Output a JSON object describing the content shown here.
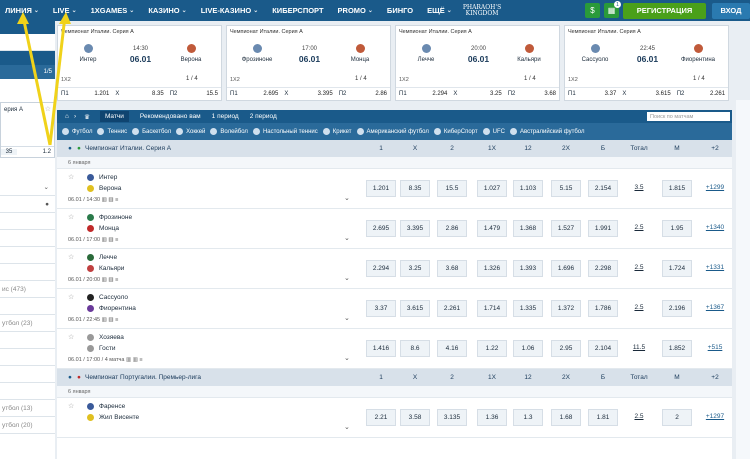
{
  "nav": {
    "items": [
      "ЛИНИЯ",
      "LIVE",
      "1XGAMES",
      "КАЗИНО",
      "LIVE-КАЗИНО",
      "КИБЕРСПОРТ",
      "PROMO",
      "БИНГО",
      "ЕЩЁ"
    ],
    "logo_line1": "PHARAOH'S",
    "logo_line2": "KINGDOM",
    "register": "РЕГИСТРАЦИЯ",
    "login": "ВХОД",
    "dollar": "$",
    "gift_badge": "1",
    "colors": {
      "nav": "#1a5a8a",
      "register": "#4aa01a"
    }
  },
  "sidebar": {
    "pager": "1/5",
    "card_text": "ерия А",
    "odds_prefix": "35",
    "odds_val": "1.2",
    "rows": [
      "",
      "",
      "",
      "",
      "",
      "",
      "ис (473)",
      "",
      "утбол (23)",
      "",
      "",
      "",
      "",
      "",
      "утбол (13)",
      "",
      "утбол (20)"
    ]
  },
  "cards": [
    {
      "league": "Чемпионат Италии. Серия А",
      "home": "Интер",
      "away": "Верона",
      "time": "14:30",
      "date": "06.01",
      "market": "1X2",
      "page": "1 / 4",
      "odds": [
        {
          "k": "П1",
          "v": "1.201"
        },
        {
          "k": "X",
          "v": "8.35"
        },
        {
          "k": "П2",
          "v": "15.5"
        }
      ]
    },
    {
      "league": "Чемпионат Италии. Серия А",
      "home": "Фрозиноне",
      "away": "Монца",
      "time": "17:00",
      "date": "06.01",
      "market": "1X2",
      "page": "1 / 4",
      "odds": [
        {
          "k": "П1",
          "v": "2.695"
        },
        {
          "k": "X",
          "v": "3.395"
        },
        {
          "k": "П2",
          "v": "2.86"
        }
      ]
    },
    {
      "league": "Чемпионат Италии. Серия А",
      "home": "Лечче",
      "away": "Кальяри",
      "time": "20:00",
      "date": "06.01",
      "market": "1X2",
      "page": "1 / 4",
      "odds": [
        {
          "k": "П1",
          "v": "2.294"
        },
        {
          "k": "X",
          "v": "3.25"
        },
        {
          "k": "П2",
          "v": "3.68"
        }
      ]
    },
    {
      "league": "Чемпионат Италии. Серия А",
      "home": "Сассуоло",
      "away": "Фиорентина",
      "time": "22:45",
      "date": "06.01",
      "market": "1X2",
      "page": "1 / 4",
      "odds": [
        {
          "k": "П1",
          "v": "3.37"
        },
        {
          "k": "X",
          "v": "3.615"
        },
        {
          "k": "П2",
          "v": "2.261"
        }
      ]
    }
  ],
  "tabs": [
    "Матчи",
    "Рекомендовано вам",
    "1 период",
    "2 период"
  ],
  "search_placeholder": "Поиск по матчам",
  "sports": [
    "Футбол",
    "Теннис",
    "Баскетбол",
    "Хоккей",
    "Волейбол",
    "Настольный теннис",
    "Крикет",
    "Американский футбол",
    "КиберСпорт",
    "UFC",
    "Австралийский футбол"
  ],
  "columns": [
    "1",
    "X",
    "2",
    "1X",
    "12",
    "2X",
    "Б",
    "Тотал",
    "М",
    "+2"
  ],
  "leagues": [
    {
      "name": "Чемпионат Италии. Серия А",
      "date": "6 января",
      "matches": [
        {
          "home": "Интер",
          "away": "Верона",
          "info": "06.01 / 14:30",
          "odds": [
            "1.201",
            "8.35",
            "15.5",
            "1.027",
            "1.103",
            "5.15",
            "2.154",
            "3.5",
            "1.815"
          ],
          "more": "+1299"
        },
        {
          "home": "Фрозиноне",
          "away": "Монца",
          "info": "06.01 / 17:00",
          "odds": [
            "2.695",
            "3.395",
            "2.86",
            "1.479",
            "1.368",
            "1.527",
            "1.991",
            "2.5",
            "1.95"
          ],
          "more": "+1340"
        },
        {
          "home": "Лечче",
          "away": "Кальяри",
          "info": "06.01 / 20:00",
          "odds": [
            "2.294",
            "3.25",
            "3.68",
            "1.326",
            "1.393",
            "1.696",
            "2.298",
            "2.5",
            "1.724"
          ],
          "more": "+1331"
        },
        {
          "home": "Сассуоло",
          "away": "Фиорентина",
          "info": "06.01 / 22:45",
          "odds": [
            "3.37",
            "3.615",
            "2.261",
            "1.714",
            "1.335",
            "1.372",
            "1.786",
            "2.5",
            "2.196"
          ],
          "more": "+1367"
        },
        {
          "home": "Хозяева",
          "away": "Гости",
          "info": "06.01 / 17:00 / 4 матча",
          "odds": [
            "1.416",
            "8.6",
            "4.16",
            "1.22",
            "1.06",
            "2.95",
            "2.104",
            "11.5",
            "1.852"
          ],
          "more": "+515"
        }
      ]
    },
    {
      "name": "Чемпионат Португалии. Премьер-лига",
      "date": "6 января",
      "matches": [
        {
          "home": "Фаренсе",
          "away": "Жил Висенте",
          "info": "",
          "odds": [
            "2.21",
            "3.58",
            "3.135",
            "1.36",
            "1.3",
            "1.68",
            "1.81",
            "2.5",
            "2"
          ],
          "more": "+1297"
        }
      ]
    }
  ]
}
